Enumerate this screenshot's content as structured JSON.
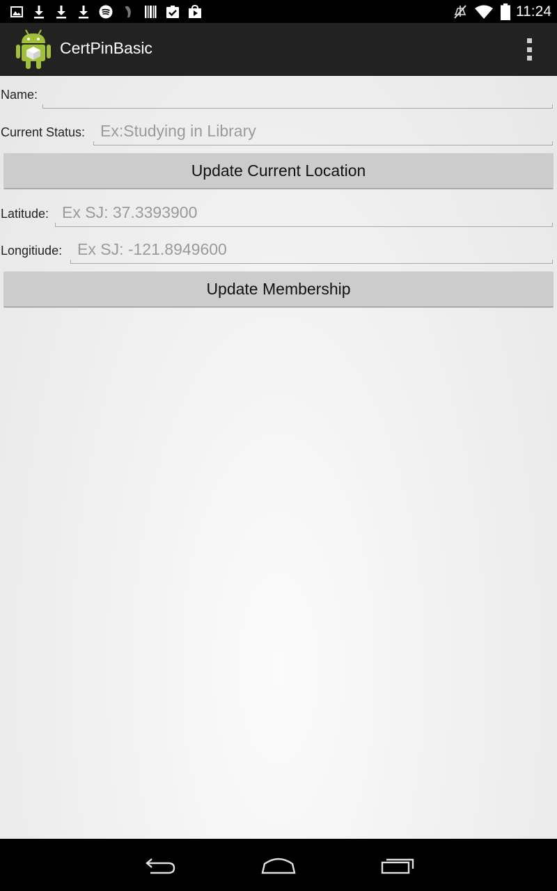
{
  "status_bar": {
    "time": "11:24",
    "left_icons": [
      "gallery-icon",
      "download-icon",
      "download-icon",
      "download-icon",
      "spotify-icon",
      "fitness-icon",
      "barcode-icon",
      "clipboard-check-icon",
      "play-store-icon"
    ],
    "right_icons": [
      "mute-icon",
      "wifi-icon",
      "battery-icon"
    ]
  },
  "action_bar": {
    "title": "CertPinBasic",
    "icon": "android-icon",
    "menu_icon": "overflow-menu-icon"
  },
  "form": {
    "name": {
      "label": "Name:",
      "value": "",
      "placeholder": ""
    },
    "status": {
      "label": "Current Status:",
      "value": "",
      "placeholder": "Ex:Studying in Library"
    },
    "update_location_button": "Update Current Location",
    "latitude": {
      "label": "Latitude:",
      "value": "",
      "placeholder": "Ex SJ: 37.3393900"
    },
    "longitude": {
      "label": "Longitiude:",
      "value": "",
      "placeholder": "Ex SJ: -121.8949600"
    },
    "update_membership_button": "Update Membership"
  },
  "nav_bar": {
    "back": "back-icon",
    "home": "home-icon",
    "recents": "recents-icon"
  },
  "colors": {
    "status_bar": "#000000",
    "action_bar": "#222222",
    "button": "#cccccc",
    "android_green": "#9fc038"
  }
}
